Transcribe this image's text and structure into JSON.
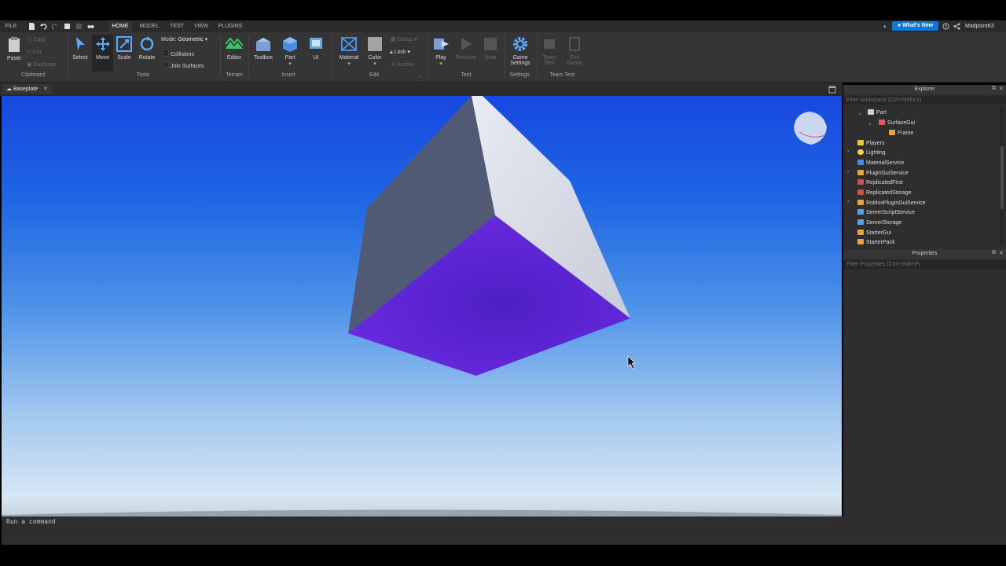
{
  "menubar": {
    "file": "FILE",
    "tabs": [
      "HOME",
      "MODEL",
      "TEST",
      "VIEW",
      "PLUGINS"
    ],
    "active_tab": "HOME",
    "whats_new": "What's New",
    "username": "Madpoint83"
  },
  "ribbon": {
    "clipboard": {
      "paste": "Paste",
      "copy": "Copy",
      "cut": "Cut",
      "duplicate": "Duplicate",
      "group": "Clipboard"
    },
    "tools": {
      "select": "Select",
      "move": "Move",
      "scale": "Scale",
      "rotate": "Rotate",
      "mode_label": "Mode:",
      "mode_value": "Geometric",
      "collisions": "Collisions",
      "join_surfaces": "Join Surfaces",
      "group": "Tools"
    },
    "terrain": {
      "editor": "Editor",
      "group": "Terrain"
    },
    "insert": {
      "toolbox": "Toolbox",
      "part": "Part",
      "ui": "UI",
      "group": "Insert"
    },
    "edit": {
      "material": "Material",
      "color": "Color",
      "group_btn": "Group",
      "lock": "Lock",
      "anchor": "Anchor",
      "group": "Edit"
    },
    "test": {
      "play": "Play",
      "resume": "Resume",
      "stop": "Stop",
      "group": "Test"
    },
    "settings": {
      "game_settings_1": "Game",
      "game_settings_2": "Settings",
      "group": "Settings"
    },
    "team_test": {
      "team_test_1": "Team",
      "team_test_2": "Test",
      "exit_game_1": "Exit",
      "exit_game_2": "Game",
      "group": "Team Test"
    }
  },
  "document_tab": {
    "label": "Baseplate"
  },
  "explorer": {
    "title": "Explorer",
    "filter_placeholder": "Filter workspace (Ctrl+Shift+X)",
    "items": [
      {
        "label": "Part",
        "color": "#d0d0d0"
      },
      {
        "label": "SurfaceGui",
        "color": "#e05a5a"
      },
      {
        "label": "Frame",
        "color": "#e8a33c"
      },
      {
        "label": "Players",
        "color": "#f0c040"
      },
      {
        "label": "Lighting",
        "color": "#f2d04a"
      },
      {
        "label": "MaterialService",
        "color": "#4a8ee0"
      },
      {
        "label": "PluginGuiService",
        "color": "#e8a33c"
      },
      {
        "label": "ReplicatedFirst",
        "color": "#d05050"
      },
      {
        "label": "ReplicatedStorage",
        "color": "#d05050"
      },
      {
        "label": "RobloxPluginGuiService",
        "color": "#e8a33c"
      },
      {
        "label": "ServerScriptService",
        "color": "#5aa0e0"
      },
      {
        "label": "ServerStorage",
        "color": "#5aa0e0"
      },
      {
        "label": "StarterGui",
        "color": "#e8a33c"
      },
      {
        "label": "StarterPack",
        "color": "#e8a33c"
      }
    ]
  },
  "properties": {
    "title": "Properties",
    "filter_placeholder": "Filter Properties (Ctrl+Shift+P)"
  },
  "command_bar": {
    "placeholder": "Run a command"
  },
  "colors": {
    "cube_purple": "#5a22d6",
    "cube_dark": "#4d5a78",
    "cube_light": "#d8dbe6",
    "accent": "#00a2ff"
  }
}
